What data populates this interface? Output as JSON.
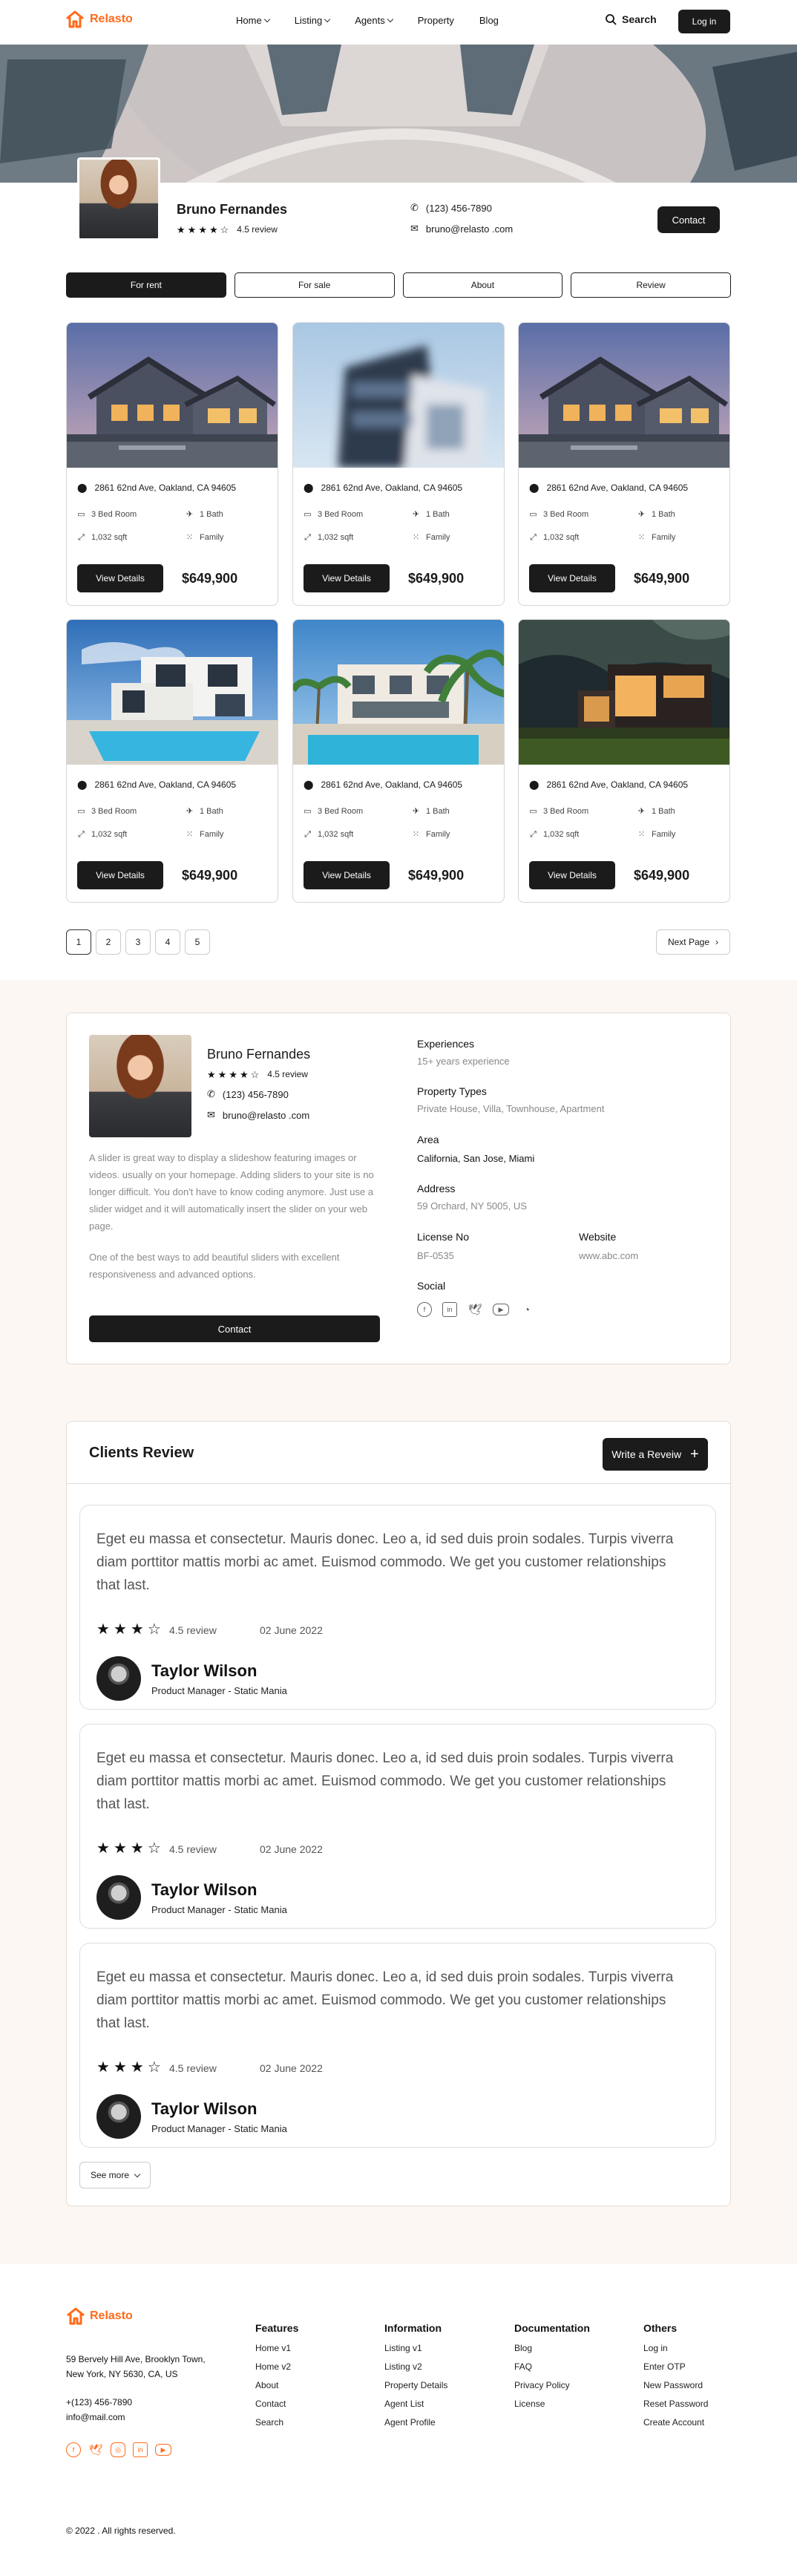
{
  "header": {
    "brand": "Relasto",
    "nav": [
      "Home",
      "Listing",
      "Agents",
      "Property",
      "Blog"
    ],
    "nav_has_dropdown": [
      true,
      true,
      true,
      false,
      false
    ],
    "search_label": "Search",
    "login_label": "Log in",
    "brand_color": "#ff6a1a"
  },
  "profile": {
    "name": "Bruno Fernandes",
    "rating_label": "4.5 review",
    "rating": 4,
    "phone": "(123) 456-7890",
    "email": "bruno@relasto .com",
    "contact_label": "Contact"
  },
  "tabs": [
    "For rent",
    "For sale",
    "About",
    "Review"
  ],
  "active_tab": "For rent",
  "listings": [
    {
      "address": "2861 62nd Ave, Oakland, CA 94605",
      "beds": "3 Bed Room",
      "baths": "1 Bath",
      "area": "1,032 sqft",
      "type": "Family",
      "button": "View Details",
      "price": "$649,900",
      "image": "house-dusk"
    },
    {
      "address": "2861 62nd Ave, Oakland, CA 94605",
      "beds": "3 Bed Room",
      "baths": "1 Bath",
      "area": "1,032 sqft",
      "type": "Family",
      "button": "View Details",
      "price": "$649,900",
      "image": "blurred-building"
    },
    {
      "address": "2861 62nd Ave, Oakland, CA 94605",
      "beds": "3 Bed Room",
      "baths": "1 Bath",
      "area": "1,032 sqft",
      "type": "Family",
      "button": "View Details",
      "price": "$649,900",
      "image": "house-dusk"
    },
    {
      "address": "2861 62nd Ave, Oakland, CA 94605",
      "beds": "3 Bed Room",
      "baths": "1 Bath",
      "area": "1,032 sqft",
      "type": "Family",
      "button": "View Details",
      "price": "$649,900",
      "image": "white-villa-pool"
    },
    {
      "address": "2861 62nd Ave, Oakland, CA 94605",
      "beds": "3 Bed Room",
      "baths": "1 Bath",
      "area": "1,032 sqft",
      "type": "Family",
      "button": "View Details",
      "price": "$649,900",
      "image": "palm-villa-pool"
    },
    {
      "address": "2861 62nd Ave, Oakland, CA 94605",
      "beds": "3 Bed Room",
      "baths": "1 Bath",
      "area": "1,032 sqft",
      "type": "Family",
      "button": "View Details",
      "price": "$649,900",
      "image": "modern-night-house"
    }
  ],
  "pagination": {
    "pages": [
      "1",
      "2",
      "3",
      "4",
      "5"
    ],
    "current": "1",
    "next_label": "Next Page"
  },
  "agent": {
    "name": "Bruno Fernandes",
    "rating_label": "4.5 review",
    "phone": "(123) 456-7890",
    "email": "bruno@relasto .com",
    "bio1": "A slider is great way to display a slideshow featuring images or videos. usually on your homepage.  Adding sliders to your site is no longer difficult. You don't have to know coding anymore. Just use a slider widget and it will automatically insert the slider on your web page.",
    "bio2": "One of the best ways to add beautiful sliders with excellent responsiveness and advanced options.",
    "contact_label": "Contact",
    "experiences_label": "Experiences",
    "experiences": "15+ years experience",
    "property_types_label": "Property Types",
    "property_types": "Private House, Villa, Townhouse, Apartment",
    "area_label": "Area",
    "area": "California, San Jose, Miami",
    "address_label": "Address",
    "address": "59 Orchard, NY 5005, US",
    "license_label": "License No",
    "license": "BF-0535",
    "website_label": "Website",
    "website": "www.abc.com",
    "social_label": "Social",
    "socials": [
      "facebook-icon",
      "linkedin-icon",
      "twitter-icon",
      "youtube-icon",
      "rss-icon"
    ]
  },
  "reviews": {
    "title": "Clients Review",
    "write_label": "Write a Reveiw",
    "items": [
      {
        "text": "Eget eu massa et consectetur. Mauris donec. Leo a, id sed duis proin sodales. Turpis viverra diam porttitor mattis morbi ac amet. Euismod commodo. We get you customer relationships that last.",
        "rating_label": "4.5 review",
        "stars": 3,
        "date": "02 June 2022",
        "name": "Taylor Wilson",
        "role": "Product Manager - Static Mania"
      },
      {
        "text": "Eget eu massa et consectetur. Mauris donec. Leo a, id sed duis proin sodales. Turpis viverra diam porttitor mattis morbi ac amet. Euismod commodo. We get you customer relationships that last.",
        "rating_label": "4.5 review",
        "stars": 3,
        "date": "02 June 2022",
        "name": "Taylor Wilson",
        "role": "Product Manager - Static Mania"
      },
      {
        "text": "Eget eu massa et consectetur. Mauris donec. Leo a, id sed duis proin sodales. Turpis viverra diam porttitor mattis morbi ac amet. Euismod commodo. We get you customer relationships that last.",
        "rating_label": "4.5 review",
        "stars": 3,
        "date": "02 June 2022",
        "name": "Taylor Wilson",
        "role": "Product Manager - Static Mania"
      }
    ],
    "see_more_label": "See more"
  },
  "footer": {
    "brand": "Relasto",
    "address_line1": "59 Bervely Hill Ave, Brooklyn Town,",
    "address_line2": "New York, NY 5630, CA, US",
    "phone": "+(123) 456-7890",
    "email": "info@mail.com",
    "socials": [
      "facebook-icon",
      "twitter-icon",
      "instagram-icon",
      "linkedin-icon",
      "youtube-icon"
    ],
    "columns": [
      {
        "title": "Features",
        "links": [
          "Home v1",
          "Home v2",
          "About",
          "Contact",
          "Search"
        ]
      },
      {
        "title": "Information",
        "links": [
          "Listing v1",
          "Listing v2",
          "Property Details",
          "Agent List",
          "Agent Profile"
        ]
      },
      {
        "title": "Documentation",
        "links": [
          "Blog",
          "FAQ",
          "Privacy Policy",
          "License"
        ]
      },
      {
        "title": "Others",
        "links": [
          "Log in",
          "Enter OTP",
          "New Password",
          "Reset Password",
          "Create Account"
        ]
      }
    ],
    "copyright": "© 2022 . All rights reserved."
  }
}
